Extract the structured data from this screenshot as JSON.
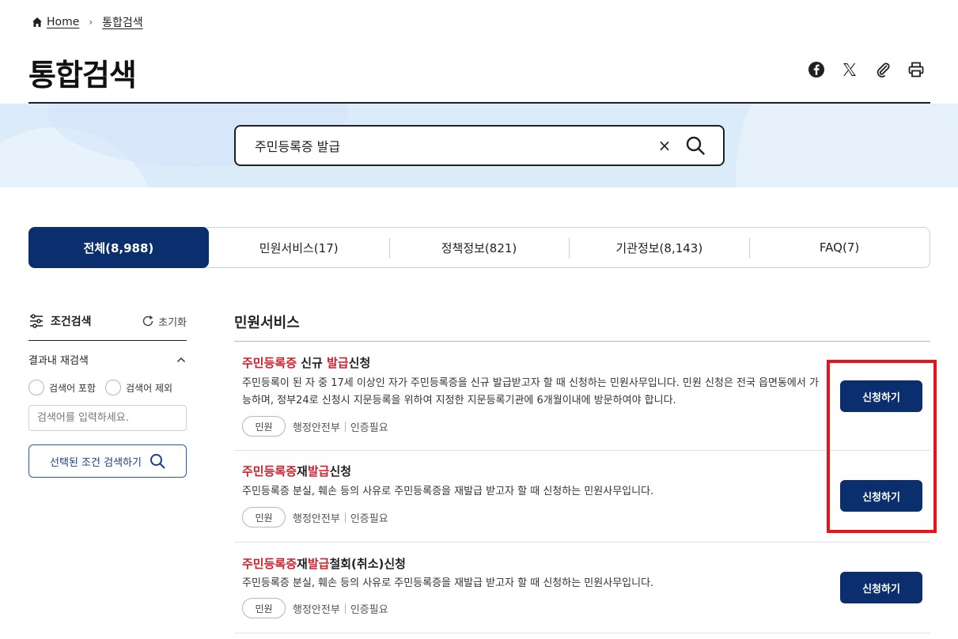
{
  "breadcrumb": {
    "home": "Home",
    "current": "통합검색",
    "home_icon": "home-icon"
  },
  "page": {
    "title": "통합검색"
  },
  "share": [
    "facebook-icon",
    "x-icon",
    "paperclip-icon",
    "print-icon"
  ],
  "search": {
    "value": "주민등록증 발급",
    "clear_label": "×"
  },
  "tabs": [
    {
      "label": "전체(8,988)",
      "active": true
    },
    {
      "label": "민원서비스(17)",
      "active": false
    },
    {
      "label": "정책정보(821)",
      "active": false
    },
    {
      "label": "기관정보(8,143)",
      "active": false
    },
    {
      "label": "FAQ(7)",
      "active": false
    }
  ],
  "filter": {
    "title": "조건검색",
    "reset": "초기화",
    "refine": "결과내 재검색",
    "include": "검색어 포함",
    "exclude": "검색어 제외",
    "placeholder": "검색어를 입력하세요.",
    "apply": "선택된 조건 검색하기"
  },
  "section": {
    "title": "민원서비스"
  },
  "results": [
    {
      "title_parts": [
        {
          "text": "주민등록증",
          "hl": true
        },
        {
          "text": " 신규 ",
          "hl": false
        },
        {
          "text": "발급",
          "hl": true
        },
        {
          "text": "신청",
          "hl": false
        }
      ],
      "desc": "주민등록이 된 자 중 17세 이상인 자가 주민등록증을 신규 발급받고자 할 때 신청하는 민원사무입니다. 민원 신청은 전국 읍면동에서 가능하며, 정부24로 신청시 지문등록을 위하여 지정한 지문등록기관에 6개월이내에 방문하여야 합니다.",
      "chip": "민원",
      "agency": "행정안전부",
      "auth": "인증필요",
      "button": "신청하기"
    },
    {
      "title_parts": [
        {
          "text": "주민등록증",
          "hl": true
        },
        {
          "text": "재",
          "hl": false
        },
        {
          "text": "발급",
          "hl": true
        },
        {
          "text": "신청",
          "hl": false
        }
      ],
      "desc": "주민등록증 분실, 훼손 등의 사유로 주민등록증을 재발급 받고자 할 때 신청하는 민원사무입니다.",
      "chip": "민원",
      "agency": "행정안전부",
      "auth": "인증필요",
      "button": "신청하기"
    },
    {
      "title_parts": [
        {
          "text": "주민등록증",
          "hl": true
        },
        {
          "text": "재",
          "hl": false
        },
        {
          "text": "발급",
          "hl": true
        },
        {
          "text": "철회(취소)신청",
          "hl": false
        }
      ],
      "desc": "주민등록증 분실, 훼손 등의 사유로 주민등록증을 재발급 받고자 할 때 신청하는 민원사무입니다.",
      "chip": "민원",
      "agency": "행정안전부",
      "auth": "인증필요",
      "button": "신청하기"
    }
  ],
  "colors": {
    "primary": "#0b2f6e",
    "highlight": "#d1202c",
    "annotation": "#e8131b"
  }
}
